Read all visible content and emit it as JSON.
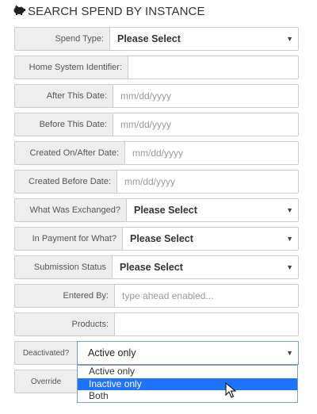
{
  "page": {
    "title": "SEARCH SPEND BY INSTANCE",
    "title_icon": "piggy-bank-icon"
  },
  "fields": [
    {
      "label": "Spend Type:",
      "value": "Please Select",
      "type": "select"
    },
    {
      "label": "Home System Identifier:",
      "value": "",
      "type": "text"
    },
    {
      "label": "After This Date:",
      "placeholder": "mm/dd/yyyy",
      "type": "date"
    },
    {
      "label": "Before This Date:",
      "placeholder": "mm/dd/yyyy",
      "type": "date"
    },
    {
      "label": "Created On/After Date:",
      "placeholder": "mm/dd/yyyy",
      "type": "date"
    },
    {
      "label": "Created Before Date:",
      "placeholder": "mm/dd/yyyy",
      "type": "date"
    },
    {
      "label": "What Was Exchanged?",
      "value": "Please Select",
      "type": "select"
    },
    {
      "label": "In Payment for What?",
      "value": "Please Select",
      "type": "select"
    },
    {
      "label": "Submission Status",
      "value": "Please Select",
      "type": "select"
    },
    {
      "label": "Entered By:",
      "placeholder": "type ahead enabled...",
      "type": "typeahead"
    },
    {
      "label": "Products:",
      "value": "",
      "type": "text"
    },
    {
      "label": "Deactivated?",
      "value": "Active only",
      "type": "select-open"
    },
    {
      "label": "Override",
      "value": "",
      "type": "partial"
    }
  ],
  "deactivated_dropdown": {
    "options": [
      "Active only",
      "Inactive only",
      "Both"
    ],
    "highlighted": "Inactive only"
  },
  "colors": {
    "label_bg": "#eeeeee",
    "border": "#cccccc",
    "highlight": "#1e73ff",
    "placeholder": "#999999"
  }
}
